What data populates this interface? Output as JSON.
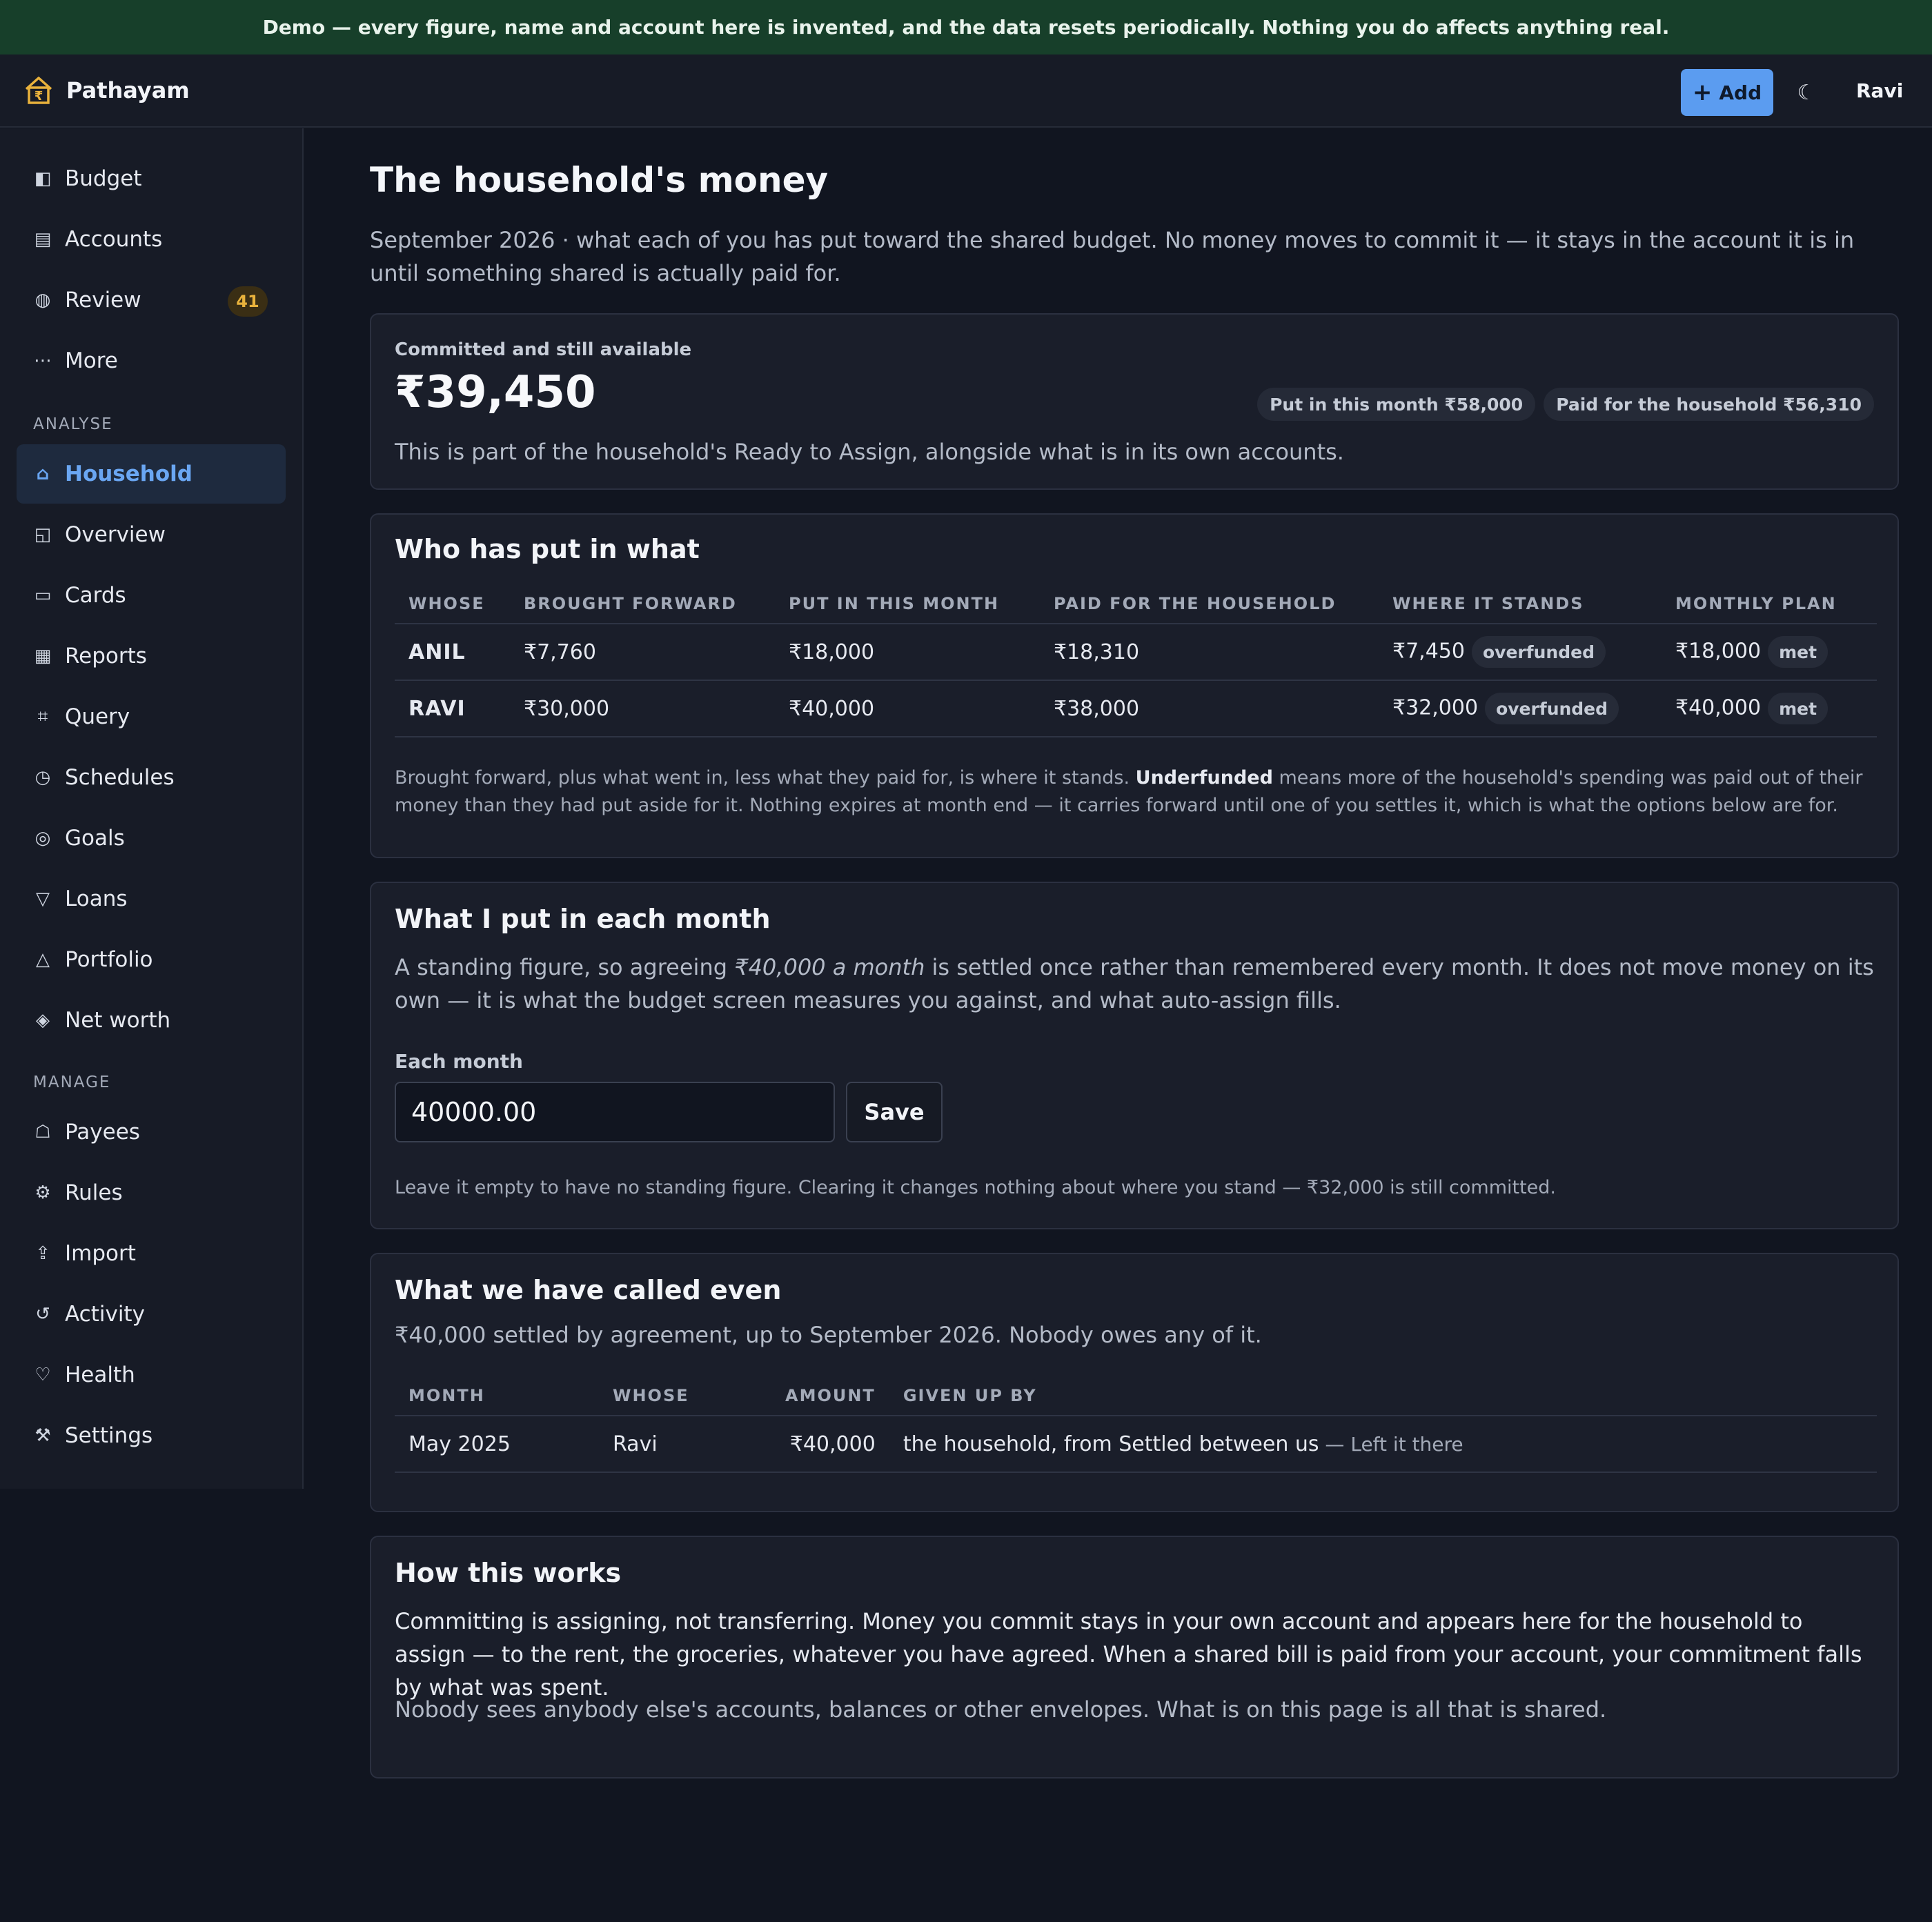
{
  "banner": {
    "text": "Demo — every figure, name and account here is invented, and the data resets periodically. Nothing you do affects anything real."
  },
  "header": {
    "brand": "Pathayam",
    "add_label": "Add",
    "theme_icon": "☾",
    "user": "Ravi"
  },
  "sidebar": {
    "primary": [
      {
        "label": "Budget",
        "icon": "◧"
      },
      {
        "label": "Accounts",
        "icon": "▤"
      },
      {
        "label": "Review",
        "icon": "◍",
        "badge": "41"
      },
      {
        "label": "More",
        "icon": "⋯"
      }
    ],
    "analyse_label": "ANALYSE",
    "analyse": [
      {
        "label": "Household",
        "icon": "⌂",
        "active": true
      },
      {
        "label": "Overview",
        "icon": "◱"
      },
      {
        "label": "Cards",
        "icon": "▭"
      },
      {
        "label": "Reports",
        "icon": "▦"
      },
      {
        "label": "Query",
        "icon": "⌗"
      },
      {
        "label": "Schedules",
        "icon": "◷"
      },
      {
        "label": "Goals",
        "icon": "◎"
      },
      {
        "label": "Loans",
        "icon": "▽"
      },
      {
        "label": "Portfolio",
        "icon": "△"
      },
      {
        "label": "Net worth",
        "icon": "◈"
      }
    ],
    "manage_label": "MANAGE",
    "manage": [
      {
        "label": "Payees",
        "icon": "☖"
      },
      {
        "label": "Rules",
        "icon": "⚙"
      },
      {
        "label": "Import",
        "icon": "⇪"
      },
      {
        "label": "Activity",
        "icon": "↺"
      },
      {
        "label": "Health",
        "icon": "♡"
      },
      {
        "label": "Settings",
        "icon": "⚒"
      }
    ]
  },
  "page": {
    "title": "The household's money",
    "intro": "September 2026 · what each of you has put toward the shared budget. No money moves to commit it — it stays in the account it is in until something shared is actually paid for."
  },
  "summary": {
    "label": "Committed and still available",
    "amount": "₹39,450",
    "pill_put_in": "Put in this month ₹58,000",
    "pill_paid": "Paid for the household ₹56,310",
    "note": "This is part of the household's Ready to Assign, alongside what is in its own accounts."
  },
  "who_put_in": {
    "title": "Who has put in what",
    "columns": [
      "WHOSE",
      "BROUGHT FORWARD",
      "PUT IN THIS MONTH",
      "PAID FOR THE HOUSEHOLD",
      "WHERE IT STANDS",
      "MONTHLY PLAN"
    ],
    "rows": [
      {
        "whose": "ANIL",
        "brought_forward": "₹7,760",
        "put_in": "₹18,000",
        "paid": "₹18,310",
        "stands": "₹7,450",
        "stands_tag": "overfunded",
        "plan": "₹18,000",
        "plan_tag": "met"
      },
      {
        "whose": "RAVI",
        "brought_forward": "₹30,000",
        "put_in": "₹40,000",
        "paid": "₹38,000",
        "stands": "₹32,000",
        "stands_tag": "overfunded",
        "plan": "₹40,000",
        "plan_tag": "met"
      }
    ],
    "foot_a": "Brought forward, plus what went in, less what they paid for, is where it stands. ",
    "foot_bold": "Underfunded",
    "foot_b": " means more of the household's spending was paid out of their money than they had put aside for it. Nothing expires at month end — it carries forward until one of you settles it, which is what the options below are for."
  },
  "monthly": {
    "title": "What I put in each month",
    "desc_a": "A standing figure, so agreeing ",
    "desc_em": "₹40,000 a month",
    "desc_b": " is settled once rather than remembered every month. It does not move money on its own — it is what the budget screen measures you against, and what auto-assign fills.",
    "field_label": "Each month",
    "field_value": "40000.00",
    "save_label": "Save",
    "hint": "Leave it empty to have no standing figure. Clearing it changes nothing about where you stand — ₹32,000 is still committed."
  },
  "even": {
    "title": "What we have called even",
    "desc": "₹40,000 settled by agreement, up to September 2026. Nobody owes any of it.",
    "columns": [
      "MONTH",
      "WHOSE",
      "AMOUNT",
      "GIVEN UP BY"
    ],
    "rows": [
      {
        "month": "May 2025",
        "whose": "Ravi",
        "amount": "₹40,000",
        "given_up_by": "the household, from Settled between us",
        "note": " — Left it there"
      }
    ]
  },
  "how": {
    "title": "How this works",
    "para1": "Committing is assigning, not transferring. Money you commit stays in your own account and appears here for the household to assign — to the rent, the groceries, whatever you have agreed. When a shared bill is paid from your account, your commitment falls by what was spent.",
    "para2": "Nobody sees anybody else's accounts, balances or other envelopes. What is on this page is all that is shared."
  },
  "colors": {
    "accent": "#5b9cf0",
    "banner": "#173f2a",
    "badge": "#e9b23c",
    "active_nav": "#6aa6f2"
  }
}
